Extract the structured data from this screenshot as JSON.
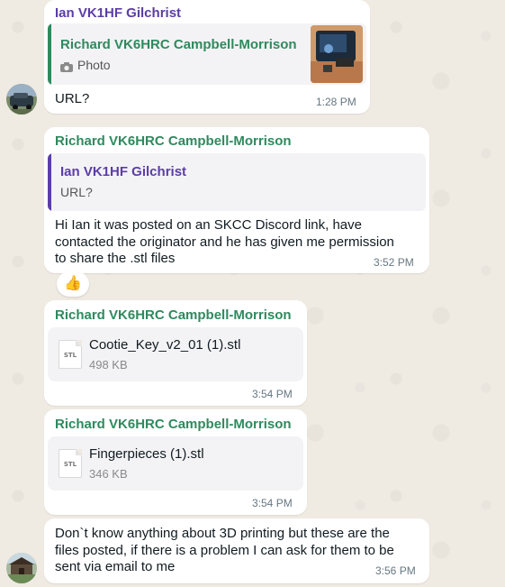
{
  "messages": [
    {
      "sender": "Ian VK1HF Gilchrist",
      "quote": {
        "sender": "Richard VK6HRC Campbell-Morrison",
        "text": "Photo",
        "icon": "camera-icon"
      },
      "text": "URL?",
      "time": "1:28 PM"
    },
    {
      "sender": "Richard VK6HRC Campbell-Morrison",
      "quote": {
        "sender": "Ian VK1HF Gilchrist",
        "text": "URL?"
      },
      "lines": [
        "Hi Ian it was posted on an SKCC Discord link, have",
        "contacted the originator and he has given me permission",
        "to share the .stl files"
      ],
      "time": "3:52 PM",
      "reaction": "👍"
    },
    {
      "sender": "Richard VK6HRC Campbell-Morrison",
      "file": {
        "name": "Cootie_Key_v2_01 (1).stl",
        "size": "498 KB",
        "ext": "STL"
      },
      "time": "3:54 PM"
    },
    {
      "sender": "Richard VK6HRC Campbell-Morrison",
      "file": {
        "name": "Fingerpieces (1).stl",
        "size": "346 KB",
        "ext": "STL"
      },
      "time": "3:54 PM"
    },
    {
      "lines": [
        "Don`t know anything about 3D printing but these are the",
        "files posted, if there is a problem I can ask for them to be",
        "sent via email to me"
      ],
      "time": "3:56 PM"
    }
  ],
  "colors": {
    "purple_sender": "#5b3da8",
    "green_sender": "#2f8a5e",
    "background": "#efeae2"
  }
}
